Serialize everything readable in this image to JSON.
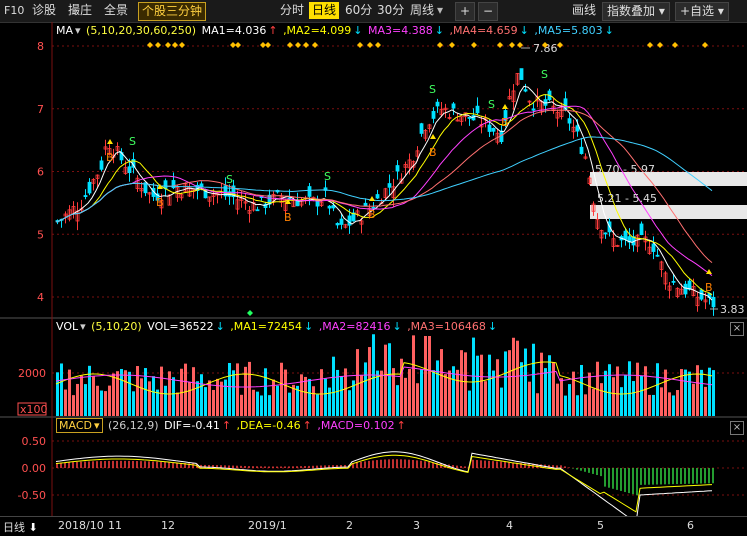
{
  "toolbar": {
    "f10": "F10",
    "diagnose": "诊股",
    "order": "撮庄",
    "fullview": "全景",
    "mode": "个股三分钟",
    "tabs": [
      "分时",
      "日线",
      "60分",
      "30分",
      "周线"
    ],
    "period_active": "日线",
    "plus": "+",
    "minus": "−",
    "draw": "画线",
    "overlay": "指数叠加",
    "watch": "+自选"
  },
  "main_legend": {
    "name": "MA",
    "params": "(5,10,20,30,60,250)",
    "ma1": "MA1=4.036",
    "ma2": ",MA2=4.099",
    "ma3": "MA3=4.388",
    "ma4": ",MA4=4.659",
    "ma5": ",MA5=5.803"
  },
  "vol_legend": {
    "name": "VOL",
    "params": "(5,10,20)",
    "vol": "VOL=36522",
    "ma1": ",MA1=72454",
    "ma2": ",MA2=82416",
    "ma3": ",MA3=106468"
  },
  "macd_legend": {
    "name": "MACD",
    "params": "(26,12,9)",
    "dif": "DIF=-0.41",
    "dea": ",DEA=-0.46",
    "macd": ",MACD=0.102"
  },
  "price_axis": [
    "8",
    "7",
    "6",
    "5",
    "4"
  ],
  "vol_axis": [
    "2000",
    "x100"
  ],
  "macd_axis": [
    "0.50",
    "0.00",
    "-0.50"
  ],
  "annotations": {
    "high": "7.86",
    "low": "3.83",
    "zone1": "5.70 - 5.97",
    "zone2": "5.21 - 5.45",
    "buy": "B",
    "sell": "S"
  },
  "date_axis": {
    "period_label": "日线",
    "ticks": [
      "2018/10",
      "11",
      "12",
      "2019/1",
      "2",
      "3",
      "4",
      "5",
      "6"
    ]
  },
  "colors": {
    "up": "#ff3b3b",
    "down": "#00e0ff",
    "ma5": "#ffffff",
    "ma10": "#ffff00",
    "ma20": "#ff40ff",
    "ma30": "#ff7070",
    "ma60": "#40d0ff",
    "grid": "#7a1010"
  }
}
